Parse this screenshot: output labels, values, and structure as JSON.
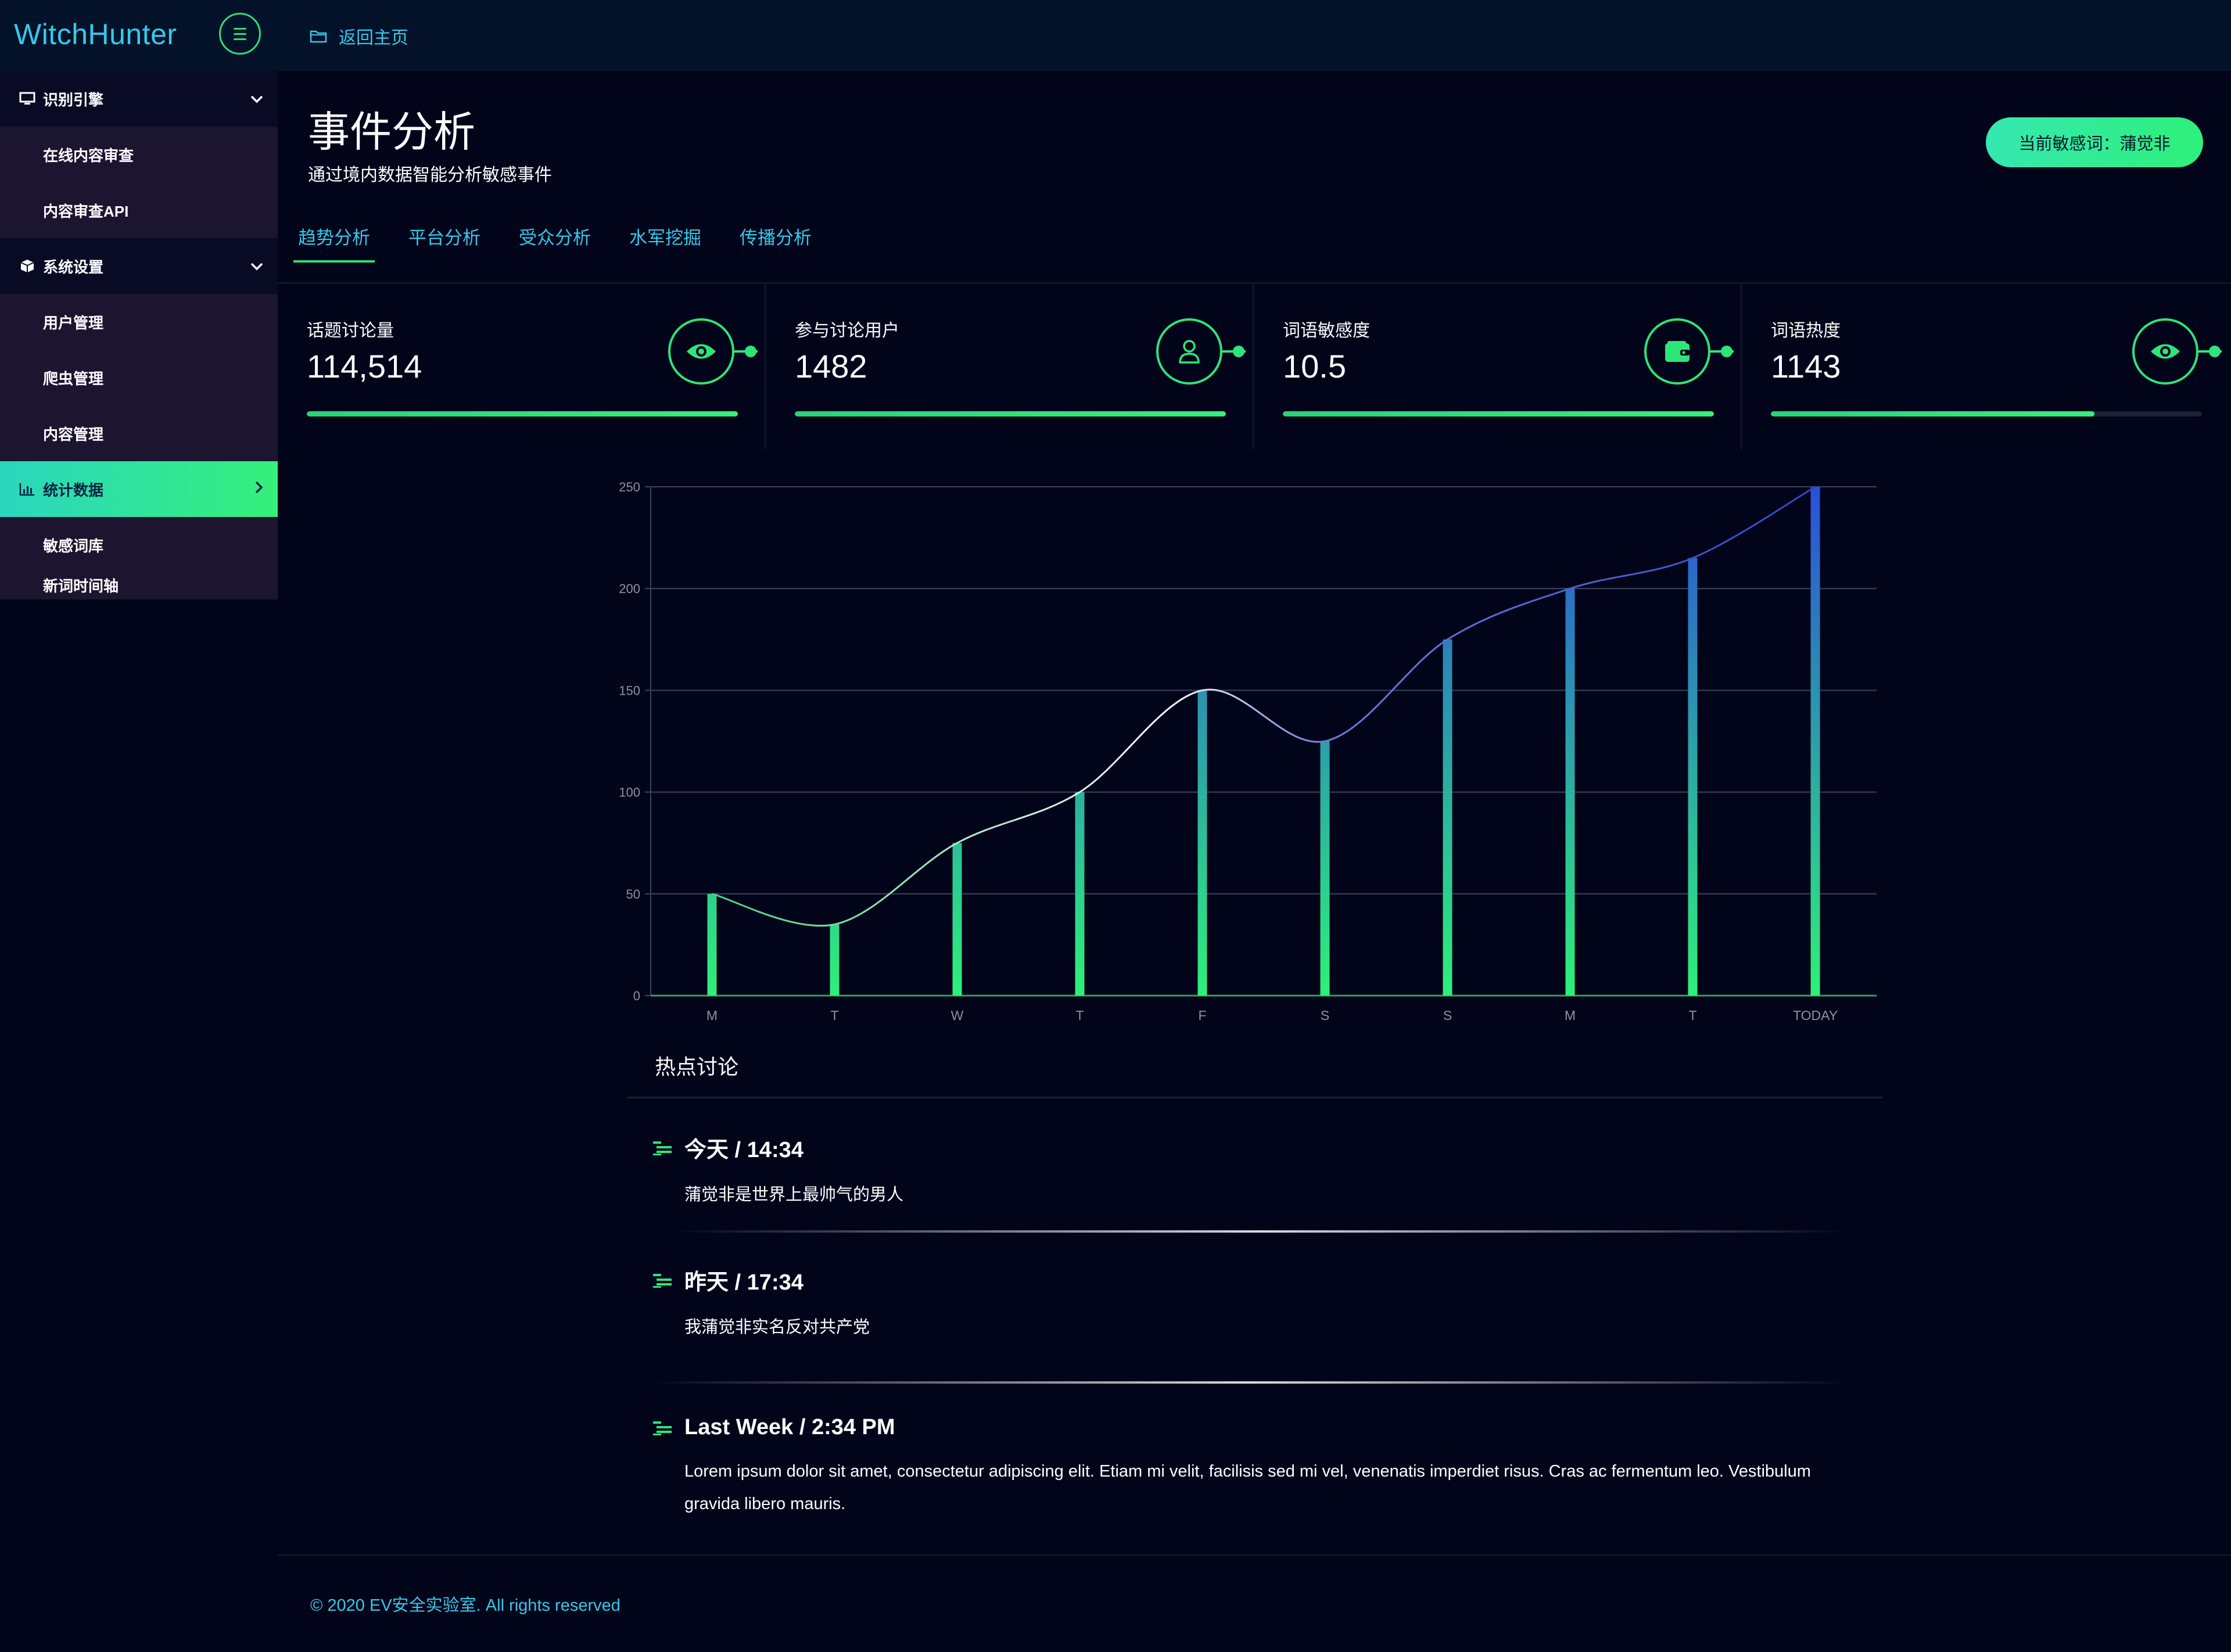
{
  "app": {
    "logo": "WitchHunter",
    "home_link": "返回主页"
  },
  "sidebar": {
    "groups": [
      {
        "label": "识别引擎",
        "items": [
          "在线内容审查",
          "内容审查API"
        ]
      },
      {
        "label": "系统设置",
        "items": [
          "用户管理",
          "爬虫管理",
          "内容管理"
        ]
      }
    ],
    "active_item": "统计数据",
    "after_items": [
      "敏感词库",
      "新词时间轴"
    ]
  },
  "page": {
    "title": "事件分析",
    "subtitle": "通过境内数据智能分析敏感事件",
    "current_word_button": "当前敏感词：蒲觉非"
  },
  "tabs": [
    "趋势分析",
    "平台分析",
    "受众分析",
    "水军挖掘",
    "传播分析"
  ],
  "active_tab": 0,
  "stats": [
    {
      "label": "话题讨论量",
      "value": "114,514",
      "icon": "eye-icon",
      "progress": 1.0
    },
    {
      "label": "参与讨论用户",
      "value": "1482",
      "icon": "user-icon",
      "progress": 1.0
    },
    {
      "label": "词语敏感度",
      "value": "10.5",
      "icon": "wallet-icon",
      "progress": 1.0
    },
    {
      "label": "词语热度",
      "value": "1143",
      "icon": "eye-icon",
      "progress": 0.75
    }
  ],
  "chart_data": {
    "type": "bar",
    "categories": [
      "M",
      "T",
      "W",
      "T",
      "F",
      "S",
      "S",
      "M",
      "T",
      "TODAY"
    ],
    "values": [
      50,
      35,
      75,
      100,
      150,
      125,
      175,
      200,
      215,
      250
    ],
    "line_overlay": true,
    "ylim": [
      0,
      250
    ],
    "yticks": [
      0,
      50,
      100,
      150,
      200,
      250
    ],
    "grid": true,
    "colors": {
      "bar_bottom": "#2ef07a",
      "bar_top": "#2a50d8",
      "line_start": "#2ecc71",
      "line_mid": "#ffffff",
      "line_end": "#2a40c8"
    }
  },
  "hot": {
    "title": "热点讨论",
    "items": [
      {
        "time": "今天 / 14:34",
        "text": "蒲觉非是世界上最帅气的男人"
      },
      {
        "time": "昨天 / 17:34",
        "text": "我蒲觉非实名反对共产党"
      },
      {
        "time": "Last Week / 2:34 PM",
        "text": "Lorem ipsum dolor sit amet, consectetur adipiscing elit. Etiam mi velit, facilisis sed mi vel, venenatis imperdiet risus. Cras ac fermentum leo. Vestibulum gravida libero mauris."
      }
    ]
  },
  "footer": "© 2020 EV安全实验室. All rights reserved"
}
